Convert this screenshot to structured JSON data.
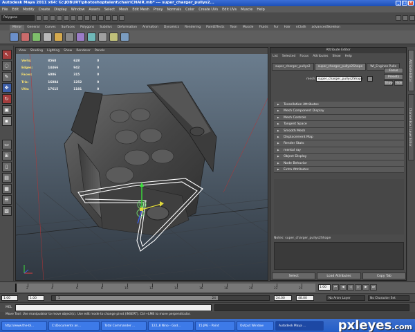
{
  "window": {
    "title": "Autodesk Maya 2011 x64: G:\\JOBURT\\photoshoptalent\\chair\\CHAIR.mb* --- super_charger_pullys2...",
    "btn_min": "_",
    "btn_max": "□",
    "btn_close": "×"
  },
  "menubar": [
    "File",
    "Edit",
    "Modify",
    "Create",
    "Display",
    "Window",
    "Assets",
    "Select",
    "Mesh",
    "Edit Mesh",
    "Proxy",
    "Normals",
    "Color",
    "Create UVs",
    "Edit UVs",
    "Muscle",
    "Help"
  ],
  "statusline": {
    "mode": "Polygons"
  },
  "shelf": {
    "tabs": [
      "Mirror",
      "General",
      "Curves",
      "Surfaces",
      "Polygons",
      "Subdivs",
      "Deformation",
      "Animation",
      "Dynamics",
      "Rendering",
      "PaintEffects",
      "Toon",
      "Muscle",
      "Fluids",
      "Fur",
      "Hair",
      "nCloth",
      "advancedSkeleton"
    ],
    "active_tab": 0
  },
  "viewport": {
    "menu": [
      "View",
      "Shading",
      "Lighting",
      "Show",
      "Renderer",
      "Panels"
    ],
    "hud": [
      {
        "label": "Verts:",
        "a": "8568",
        "b": "628",
        "c": "0"
      },
      {
        "label": "Edges:",
        "a": "14466",
        "b": "942",
        "c": "0"
      },
      {
        "label": "Faces:",
        "a": "6006",
        "b": "315",
        "c": "0"
      },
      {
        "label": "Tris:",
        "a": "16884",
        "b": "1252",
        "c": "0"
      },
      {
        "label": "UVs:",
        "a": "17615",
        "b": "1181",
        "c": "0"
      }
    ]
  },
  "attribute_editor": {
    "title": "Attribute Editor",
    "menu": [
      "List",
      "Selected",
      "Focus",
      "Attributes",
      "Show",
      "Help"
    ],
    "tabs": [
      "super_charger_pullys2",
      "super_charger_pullys2Shape",
      "WI_Engines Pulle"
    ],
    "active_tab": 1,
    "mesh_label": "mesh:",
    "mesh_value": "super_charger_pullys2Shape",
    "focus_btn": "Focus",
    "presets_btn": "Presets",
    "show_btn": "Show",
    "hide_btn": "Hide",
    "sections": [
      "Tessellation Attributes",
      "Mesh Component Display",
      "Mesh Controls",
      "Tangent Space",
      "Smooth Mesh",
      "Displacement Map",
      "Render Stats",
      "mental ray",
      "Object Display",
      "Node Behavior",
      "Extra Attributes"
    ],
    "notes_label": "Notes: super_charger_pullys2Shape",
    "buttons": [
      "Select",
      "Load Attributes",
      "Copy Tab"
    ]
  },
  "side_tabs": [
    "Attribute Editor",
    "Channel Box / Layer Editor"
  ],
  "timeline": {
    "ticks": [
      "2",
      "4",
      "6",
      "8",
      "10",
      "12",
      "14",
      "16",
      "18",
      "20",
      "22",
      "24"
    ],
    "current": "1.00"
  },
  "range": {
    "start": "1.00",
    "inner_start": "1.00",
    "inner_start_label": "1",
    "inner_end_label": "24",
    "end": "24.00",
    "end2": "48.00",
    "anim_layer": "No Anim Layer",
    "char_set": "No Character Set"
  },
  "mel": {
    "label": "MEL"
  },
  "helpline": "Move Tool: Use manipulator to move object(s). Use edit mode to change pivot (INSERT). Ctrl+LMB to move perpendicular.",
  "taskbar": [
    "http://www.the-bl...",
    "C:\\Documents an...",
    "Total Commander ...",
    "122_8 Nino - God...",
    "15.JPG - Paint",
    "Output Window",
    "Autodesk Maya ..."
  ],
  "taskbar_active": 6,
  "watermark": {
    "main": "pxleyes",
    "suffix": ".com"
  }
}
